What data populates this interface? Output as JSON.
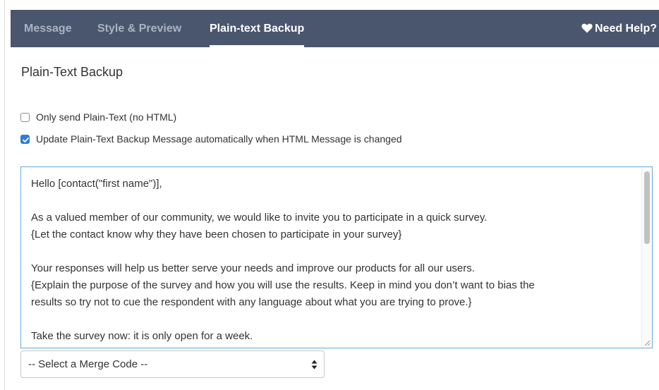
{
  "tabs": {
    "message": "Message",
    "style_preview": "Style & Preview",
    "plain_text_backup": "Plain-text Backup"
  },
  "help": {
    "label": "Need Help?",
    "icon": "heart-icon"
  },
  "section": {
    "title": "Plain-Text Backup"
  },
  "options": {
    "only_plain_text": {
      "label": "Only send Plain-Text (no HTML)",
      "checked": false
    },
    "auto_update": {
      "label": "Update Plain-Text Backup Message automatically when HTML Message is changed",
      "checked": true
    }
  },
  "message_body": {
    "greeting": "Hello [contact(\"first name\")],",
    "para1_line1": "As a valued member of our community, we would like to invite you to participate in a quick survey.",
    "para1_line2": "{Let the contact know why they have been chosen to participate in your survey}",
    "para2_line1": "Your responses will help us better serve your needs and improve our products for all our users.",
    "para2_line2": "{Explain the purpose of the survey and how you will use the results. Keep in mind you don’t want to bias the",
    "para2_line3": "results so try not to cue the respondent with any language about what you are trying to prove.}",
    "para3_line1": "Take the survey now: it is only open for a week."
  },
  "merge_code_select": {
    "selected": "-- Select a Merge Code --"
  },
  "colors": {
    "tabbar": "#4a566e",
    "tab_inactive": "#aab3c5",
    "checkbox_checked": "#2d7cdb",
    "textarea_focus_border": "#66aadf"
  }
}
